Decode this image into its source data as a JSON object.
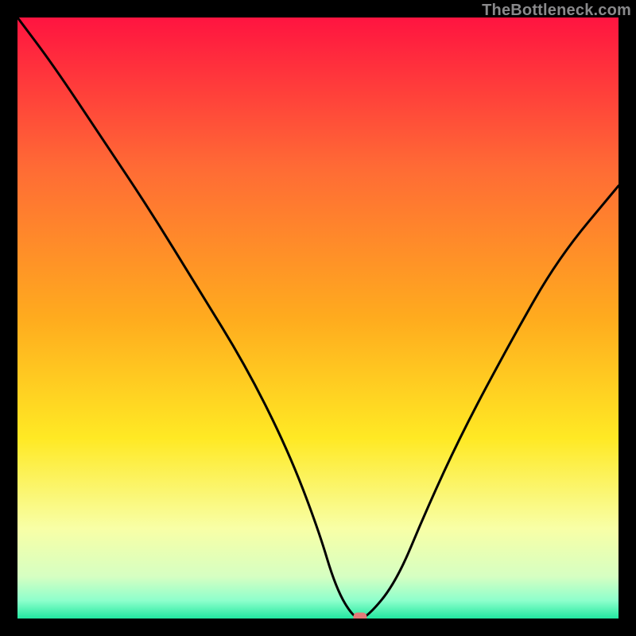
{
  "watermark": "TheBottleneck.com",
  "chart_data": {
    "type": "line",
    "title": "",
    "xlabel": "",
    "ylabel": "",
    "xlim": [
      0,
      100
    ],
    "ylim": [
      0,
      100
    ],
    "grid": false,
    "legend": false,
    "background": {
      "type": "vertical-gradient",
      "stops": [
        {
          "pos": 0.0,
          "color": "#ff1440"
        },
        {
          "pos": 0.25,
          "color": "#ff6b35"
        },
        {
          "pos": 0.5,
          "color": "#ffab1e"
        },
        {
          "pos": 0.7,
          "color": "#ffe924"
        },
        {
          "pos": 0.85,
          "color": "#f8ffa6"
        },
        {
          "pos": 0.93,
          "color": "#d6ffc2"
        },
        {
          "pos": 0.97,
          "color": "#8effcc"
        },
        {
          "pos": 1.0,
          "color": "#22e8a0"
        }
      ]
    },
    "series": [
      {
        "name": "bottleneck-curve",
        "color": "#000000",
        "x": [
          0,
          6,
          14,
          22,
          30,
          38,
          45,
          50,
          53,
          56,
          58,
          63,
          68,
          74,
          82,
          90,
          100
        ],
        "values": [
          100,
          92,
          80,
          68,
          55,
          42,
          28,
          15,
          5,
          0,
          0,
          6,
          18,
          31,
          46,
          60,
          72
        ]
      }
    ],
    "marker": {
      "name": "optimal-point",
      "x": 57,
      "y": 0,
      "color": "#e37a78",
      "shape": "capsule"
    }
  }
}
